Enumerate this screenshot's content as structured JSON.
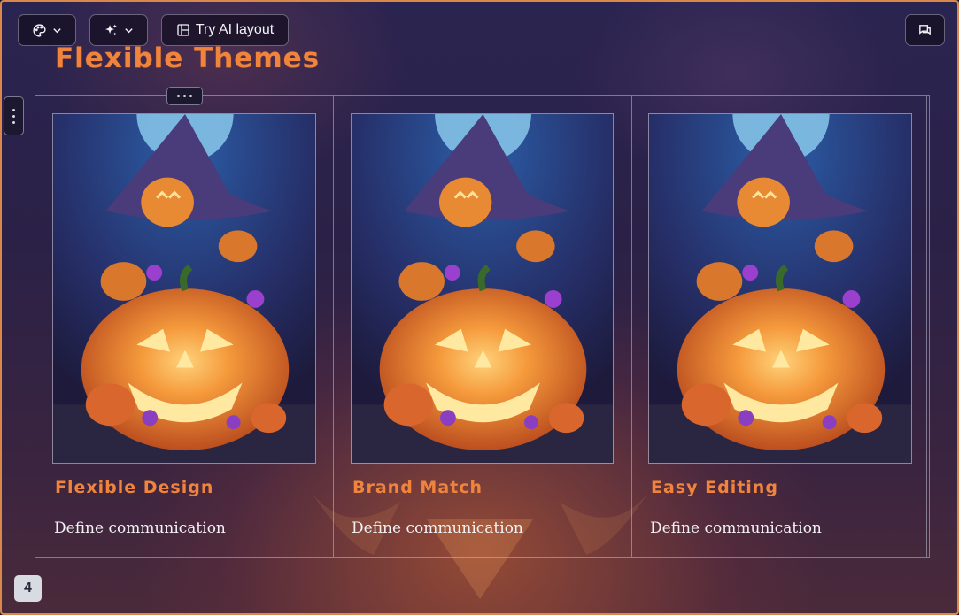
{
  "toolbar": {
    "theme_icon": "palette-icon",
    "ai_icon": "sparkles-icon",
    "layout_label": "Try AI layout",
    "comments_icon": "comments-icon"
  },
  "slide": {
    "title": "Flexible Themes",
    "page_number": "4",
    "cards": [
      {
        "title": "Flexible Design",
        "body": "Define communication",
        "image": "halloween-pumpkin-witch-image"
      },
      {
        "title": "Brand Match",
        "body": "Define communication",
        "image": "halloween-pumpkin-witch-image"
      },
      {
        "title": "Easy Editing",
        "body": "Define communication",
        "image": "halloween-pumpkin-witch-image"
      }
    ]
  },
  "colors": {
    "accent": "#f0843c",
    "border": "#d9884a",
    "background": "#2a2450"
  }
}
